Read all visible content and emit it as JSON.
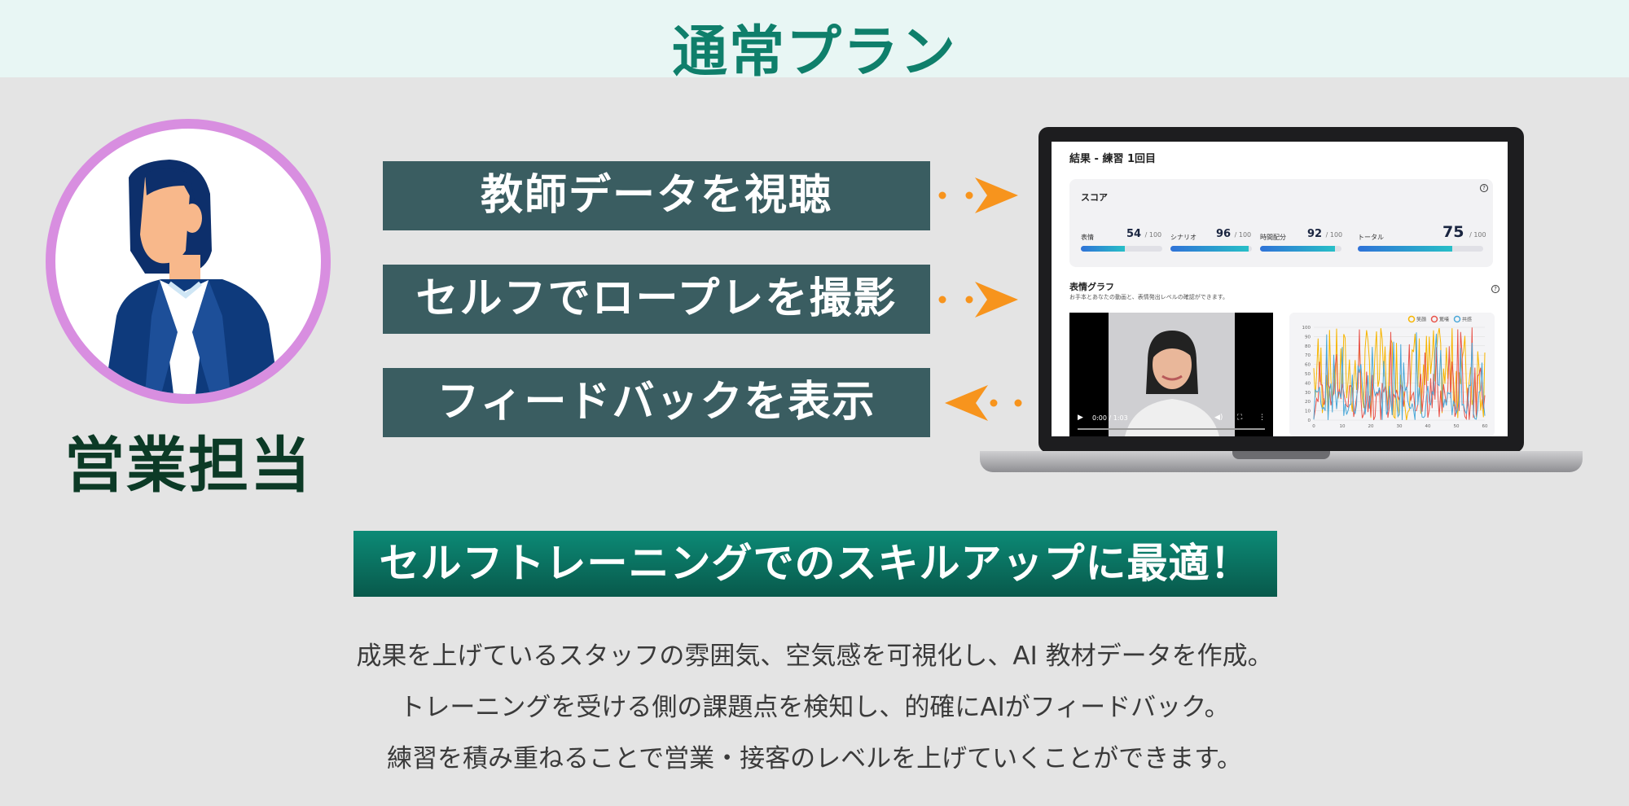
{
  "header": {
    "title": "通常プラン"
  },
  "persona": {
    "role": "営業担当"
  },
  "steps": [
    {
      "label": "教師データを視聴",
      "direction": "right"
    },
    {
      "label": "セルフでロープレを撮影",
      "direction": "right"
    },
    {
      "label": "フィードバックを表示",
      "direction": "left"
    }
  ],
  "colors": {
    "accent": "#0f7f6b",
    "step_bg": "#3a5d61",
    "arrow": "#f7941d",
    "avatar_ring": "#d88ee0"
  },
  "laptop_screen": {
    "title": "結果 - 練習 1回目",
    "score_section": {
      "title": "スコア",
      "help_icon": "?",
      "items": [
        {
          "label": "表情",
          "score": "54",
          "max": "/ 100",
          "fraction": 0.54
        },
        {
          "label": "シナリオ",
          "score": "96",
          "max": "/ 100",
          "fraction": 0.96
        },
        {
          "label": "時間配分",
          "score": "92",
          "max": "/ 100",
          "fraction": 0.92
        },
        {
          "label": "トータル",
          "score": "75",
          "max": "/ 100",
          "fraction": 0.75
        }
      ]
    },
    "expression_section": {
      "title": "表情グラフ",
      "subtitle": "お手本とあなたの動画と、表情発出レベルの確認ができます。",
      "help_icon": "?"
    },
    "video": {
      "time": "0:00 / 1:03"
    },
    "chart_data": {
      "type": "line",
      "legend": [
        "笑顔",
        "驚嘆",
        "共感"
      ],
      "legend_colors": [
        "#f7b500",
        "#e8534a",
        "#4aa8d8"
      ],
      "ylim": [
        0,
        100
      ],
      "y_ticks": [
        "100",
        "90",
        "80",
        "70",
        "60",
        "50",
        "40",
        "30",
        "20",
        "10",
        "0"
      ],
      "x_ticks": [
        "0",
        "10",
        "20",
        "30",
        "40",
        "50",
        "60"
      ],
      "grid": true
    }
  },
  "banner": {
    "text": "セルフトレーニングでのスキルアップに最適！"
  },
  "description": [
    "成果を上げているスタッフの雰囲気、空気感を可視化し、AI 教材データを作成。",
    "トレーニングを受ける側の課題点を検知し、的確にAIがフィードバック。",
    "練習を積み重ねることで営業・接客のレベルを上げていくことができます。"
  ]
}
